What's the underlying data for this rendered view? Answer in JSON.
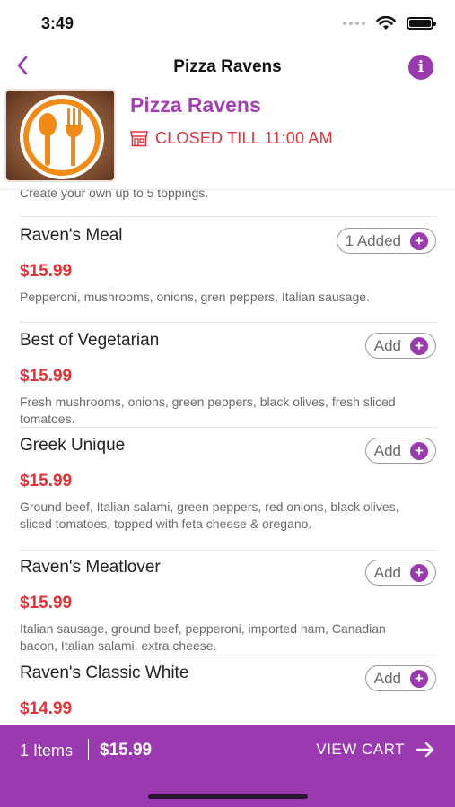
{
  "status_bar": {
    "time": "3:49",
    "icons": [
      "signal-dots-icon",
      "wifi-icon",
      "battery-icon"
    ]
  },
  "nav": {
    "title": "Pizza Ravens",
    "back_icon": "chevron-left-icon",
    "info_label": "i"
  },
  "restaurant": {
    "name": "Pizza Ravens",
    "status": "CLOSED TILL 11:00 AM",
    "status_icon": "storefront-icon",
    "logo_icon": "spoon-fork-logo"
  },
  "menu": {
    "cut_off_description": "Create your own up to 5 toppings.",
    "items": [
      {
        "name": "Raven's Meal",
        "price": "$15.99",
        "description": "Pepperoni, mushrooms, onions, gren peppers, Italian sausage.",
        "button_label": "1 Added"
      },
      {
        "name": "Best of Vegetarian",
        "price": "$15.99",
        "description": "Fresh mushrooms, onions, green peppers, black olives, fresh sliced tomatoes.",
        "button_label": "Add"
      },
      {
        "name": "Greek Unique",
        "price": "$15.99",
        "description": "Ground beef, Italian salami, green peppers, red onions, black olives, sliced tomatoes, topped with feta cheese & oregano.",
        "button_label": "Add"
      },
      {
        "name": "Raven's Meatlover",
        "price": "$15.99",
        "description": "Italian sausage, ground beef, pepperoni, imported ham, Canadian bacon, Italian salami, extra cheese.",
        "button_label": "Add"
      },
      {
        "name": "Raven's Classic White",
        "price": "$14.99",
        "description": "",
        "button_label": "Add"
      }
    ]
  },
  "cart": {
    "count_label": "1 Items",
    "total": "$15.99",
    "view_label": "VIEW CART",
    "arrow_icon": "arrow-right-icon"
  },
  "colors": {
    "accent": "#9b3ab0",
    "price_red": "#e53238",
    "brand_purple": "#a33fb3"
  }
}
